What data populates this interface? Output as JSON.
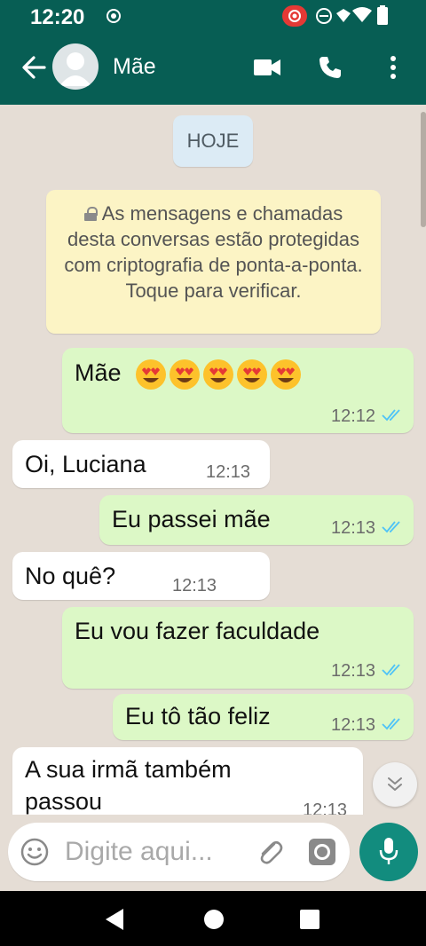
{
  "status_bar": {
    "time": "12:20"
  },
  "header": {
    "contact_name": "Mãe",
    "icons": [
      "back-arrow-icon",
      "avatar",
      "video-call-icon",
      "phone-icon",
      "more-options-icon"
    ]
  },
  "chat": {
    "date_label": "HOJE",
    "encryption_notice": "As mensagens e chamadas desta conversas estão protegidas com criptografia de ponta-a-ponta. Toque para verificar.",
    "messages": [
      {
        "direction": "out",
        "text": "Mãe",
        "emoji": "😍😍😍😍😍",
        "time": "12:12",
        "status": "read"
      },
      {
        "direction": "in",
        "text": "Oi, Luciana",
        "time": "12:13"
      },
      {
        "direction": "out",
        "text": "Eu passei mãe",
        "time": "12:13",
        "status": "read"
      },
      {
        "direction": "in",
        "text": "No quê?",
        "time": "12:13"
      },
      {
        "direction": "out",
        "text": "Eu vou fazer faculdade",
        "time": "12:13",
        "status": "read"
      },
      {
        "direction": "out",
        "text": "Eu tô tão feliz",
        "time": "12:13",
        "status": "read"
      },
      {
        "direction": "in",
        "text_line1": "A sua irmã também",
        "text_line2": "passou",
        "time": "12:13"
      }
    ]
  },
  "composer": {
    "placeholder": "Digite aqui..."
  },
  "colors": {
    "header": "#075e54",
    "outgoing_bubble": "#dcf8c6",
    "incoming_bubble": "#ffffff",
    "chat_background": "#e5ddd5",
    "read_ticks": "#4fc3f7",
    "mic_button": "#128c7e"
  }
}
